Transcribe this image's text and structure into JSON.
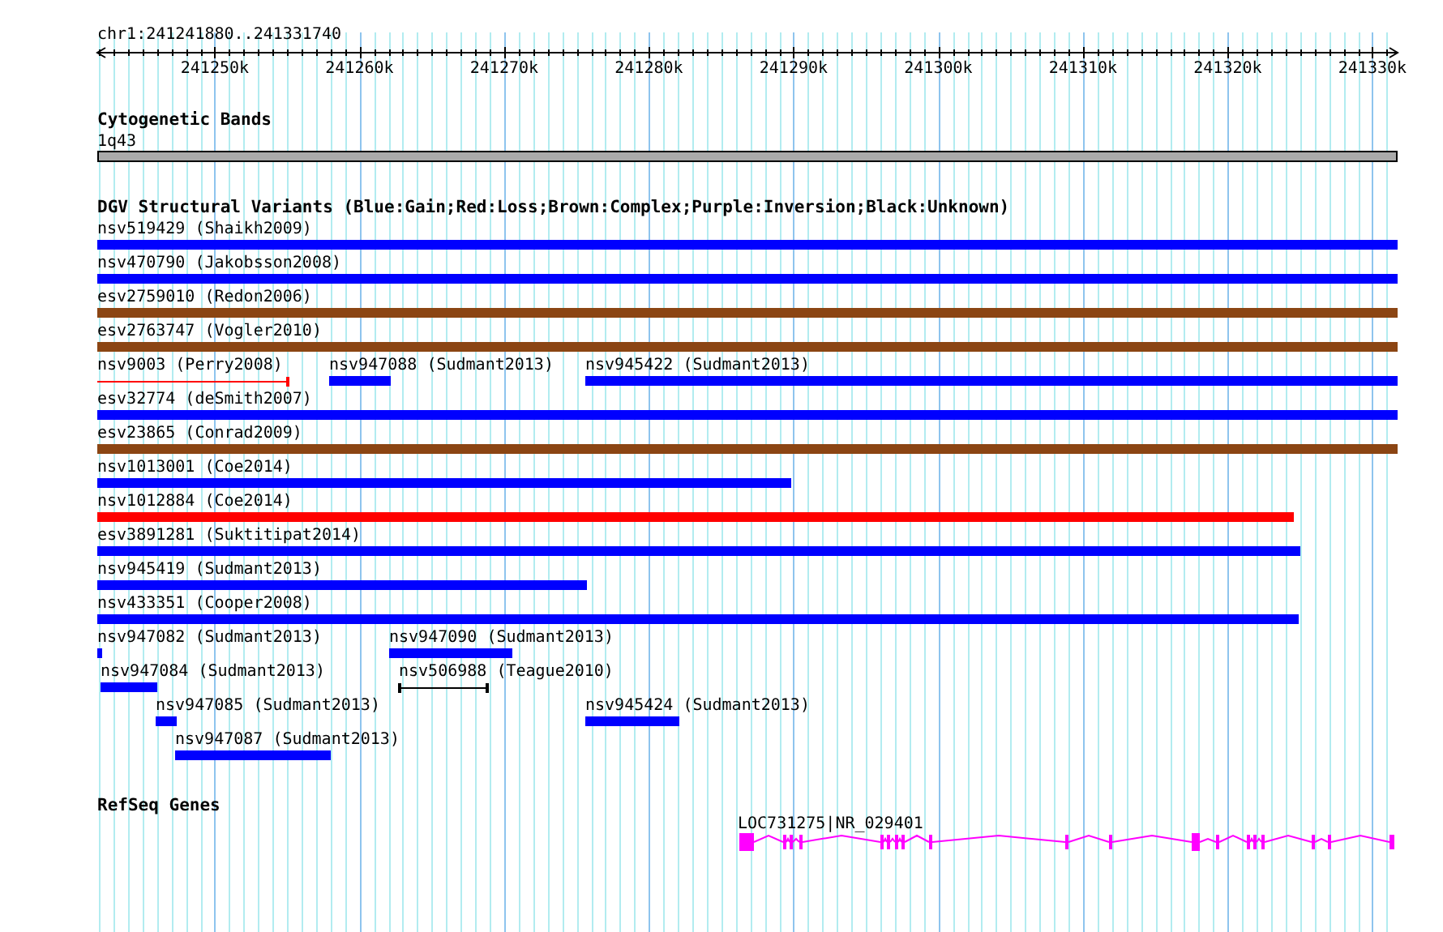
{
  "ruler": {
    "location": "chr1:241241880..241331740",
    "tick_labels": [
      "241250k",
      "241260k",
      "241270k",
      "241280k",
      "241290k",
      "241300k",
      "241310k",
      "241320k",
      "241330k"
    ]
  },
  "cytogenetic_bands": {
    "title": "Cytogenetic Bands",
    "band": "1q43"
  },
  "dgv_structural_variants": {
    "title": "DGV Structural Variants (Blue:Gain;Red:Loss;Brown:Complex;Purple:Inversion;Black:Unknown)",
    "features": [
      {
        "label": "nsv519429 (Shaikh2009)",
        "color": "#0000ff",
        "kind": "bar"
      },
      {
        "label": "nsv470790 (Jakobsson2008)",
        "color": "#0000ff",
        "kind": "bar"
      },
      {
        "label": "esv2759010 (Redon2006)",
        "color": "#8b4513",
        "kind": "bar"
      },
      {
        "label": "esv2763747 (Vogler2010)",
        "color": "#8b4513",
        "kind": "bar"
      },
      {
        "label": "nsv9003 (Perry2008)",
        "color": "#ff0000",
        "kind": "range"
      },
      {
        "label": "nsv947088 (Sudmant2013)",
        "color": "#0000ff",
        "kind": "bar"
      },
      {
        "label": "nsv945422 (Sudmant2013)",
        "color": "#0000ff",
        "kind": "bar"
      },
      {
        "label": "esv32774 (deSmith2007)",
        "color": "#0000ff",
        "kind": "bar"
      },
      {
        "label": "esv23865 (Conrad2009)",
        "color": "#8b4513",
        "kind": "bar"
      },
      {
        "label": "nsv1013001 (Coe2014)",
        "color": "#0000ff",
        "kind": "bar"
      },
      {
        "label": "nsv1012884 (Coe2014)",
        "color": "#ff0000",
        "kind": "bar"
      },
      {
        "label": "esv3891281 (Suktitipat2014)",
        "color": "#0000ff",
        "kind": "bar"
      },
      {
        "label": "nsv945419 (Sudmant2013)",
        "color": "#0000ff",
        "kind": "bar"
      },
      {
        "label": "nsv433351 (Cooper2008)",
        "color": "#0000ff",
        "kind": "bar"
      },
      {
        "label": "nsv947082 (Sudmant2013)",
        "color": "#0000ff",
        "kind": "bar"
      },
      {
        "label": "nsv947090 (Sudmant2013)",
        "color": "#0000ff",
        "kind": "bar"
      },
      {
        "label": "nsv947084 (Sudmant2013)",
        "color": "#0000ff",
        "kind": "bar"
      },
      {
        "label": "nsv506988 (Teague2010)",
        "color": "#000000",
        "kind": "range"
      },
      {
        "label": "nsv947085 (Sudmant2013)",
        "color": "#0000ff",
        "kind": "bar"
      },
      {
        "label": "nsv945424 (Sudmant2013)",
        "color": "#0000ff",
        "kind": "bar"
      },
      {
        "label": "nsv947087 (Sudmant2013)",
        "color": "#0000ff",
        "kind": "bar"
      }
    ]
  },
  "refseq_genes": {
    "title": "RefSeq Genes",
    "gene_label": "LOC731275|NR_029401"
  }
}
